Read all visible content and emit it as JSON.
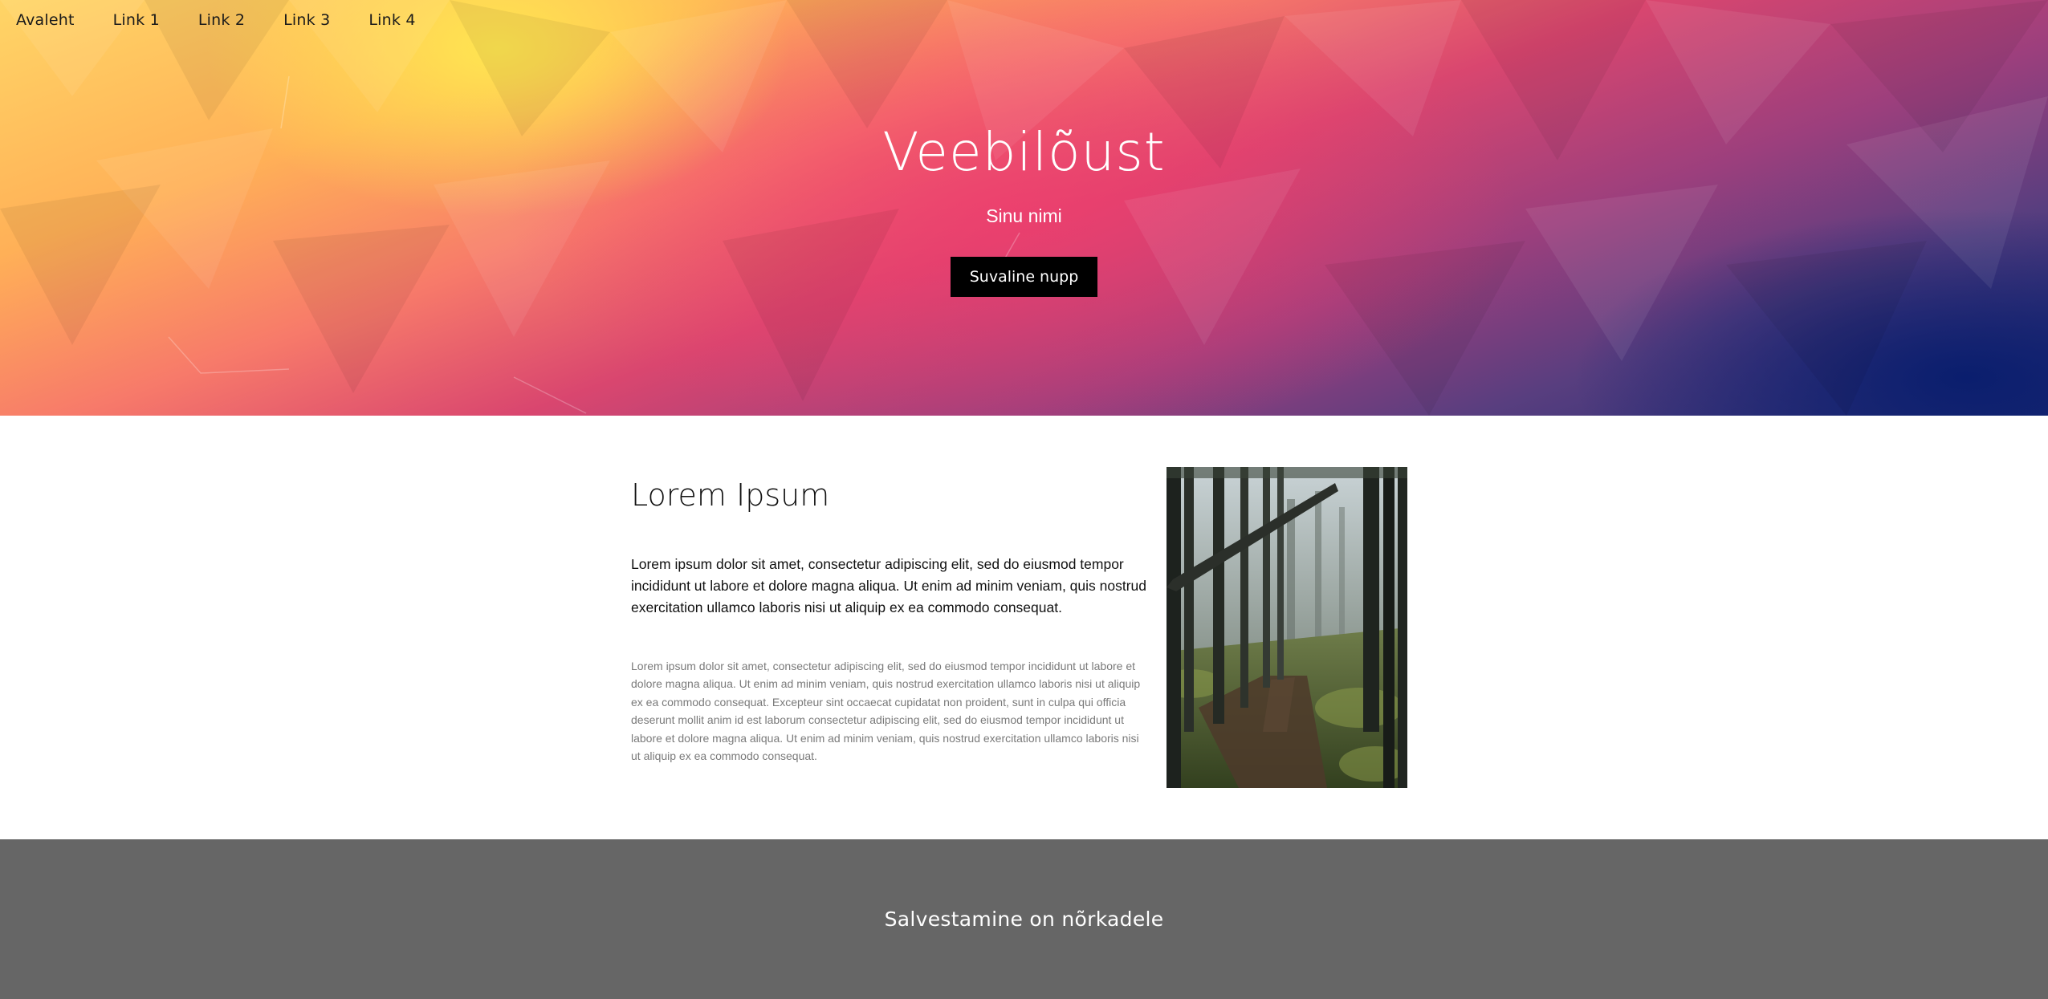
{
  "nav": {
    "links": [
      "Avaleht",
      "Link 1",
      "Link 2",
      "Link 3",
      "Link 4"
    ]
  },
  "hero": {
    "title": "Veebilõust",
    "subtitle": "Sinu nimi",
    "button_label": "Suvaline nupp"
  },
  "content": {
    "title": "Lorem Ipsum",
    "lead": "Lorem ipsum dolor sit amet, consectetur adipiscing elit, sed do eiusmod tempor incididunt ut labore et dolore magna aliqua. Ut enim ad minim veniam, quis nostrud exercitation ullamco laboris nisi ut aliquip ex ea commodo consequat.",
    "body": "Lorem ipsum dolor sit amet, consectetur adipiscing elit, sed do eiusmod tempor incididunt ut labore et dolore magna aliqua. Ut enim ad minim veniam, quis nostrud exercitation ullamco laboris nisi ut aliquip ex ea commodo consequat. Excepteur sint occaecat cupidatat non proident, sunt in culpa qui officia deserunt mollit anim id est laborum consectetur adipiscing elit, sed do eiusmod tempor incididunt ut labore et dolore magna aliqua. Ut enim ad minim veniam, quis nostrud exercitation ullamco laboris nisi ut aliquip ex ea commodo consequat."
  },
  "footer": {
    "text": "Salvestamine on nõrkadele"
  },
  "colors": {
    "button_bg": "#000000",
    "footer_bg": "#666666",
    "muted_text": "#7a7a7a"
  }
}
